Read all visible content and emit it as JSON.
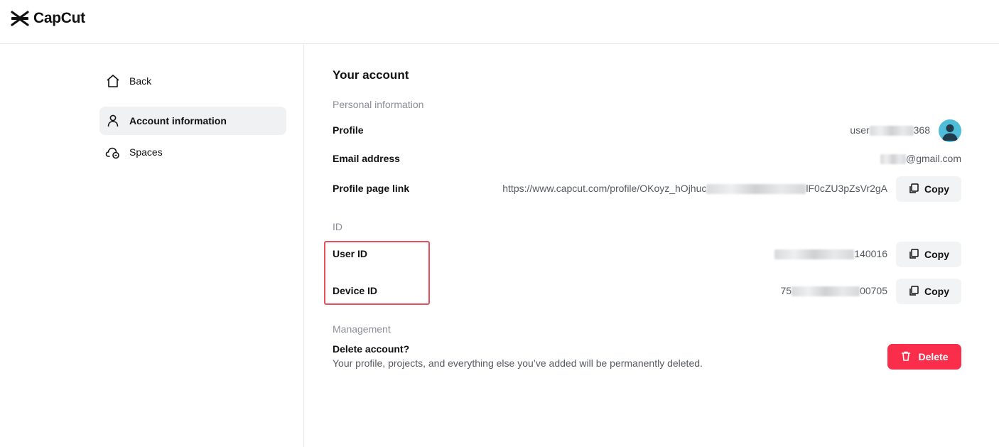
{
  "app": {
    "brand": "CapCut"
  },
  "sidebar": {
    "items": [
      {
        "label": "Back",
        "icon": "home-icon"
      },
      {
        "label": "Account information",
        "icon": "person-icon",
        "active": true
      },
      {
        "label": "Spaces",
        "icon": "cloud-icon"
      }
    ]
  },
  "main": {
    "title": "Your account",
    "personal": {
      "heading": "Personal information",
      "profile_label": "Profile",
      "profile_value_prefix": "user",
      "profile_value_suffix": "368",
      "email_label": "Email address",
      "email_value_suffix": "@gmail.com",
      "link_label": "Profile page link",
      "link_value_prefix": "https://www.capcut.com/profile/OKoyz_hOjhuc",
      "link_value_suffix": "lF0cZU3pZsVr2gA",
      "copy_label": "Copy"
    },
    "id": {
      "heading": "ID",
      "user_id_label": "User ID",
      "user_id_suffix": "140016",
      "device_id_label": "Device ID",
      "device_id_prefix": "75",
      "device_id_suffix": "00705",
      "copy_label": "Copy"
    },
    "management": {
      "heading": "Management",
      "delete_title": "Delete account?",
      "delete_desc": "Your profile, projects, and everything else you’ve added will be permanently deleted.",
      "delete_button": "Delete"
    }
  },
  "colors": {
    "accent_red": "#fa2d4b",
    "highlight_red": "#e84e5c",
    "avatar_bg": "#4fbdd8",
    "active_bg": "#eff1f3"
  }
}
